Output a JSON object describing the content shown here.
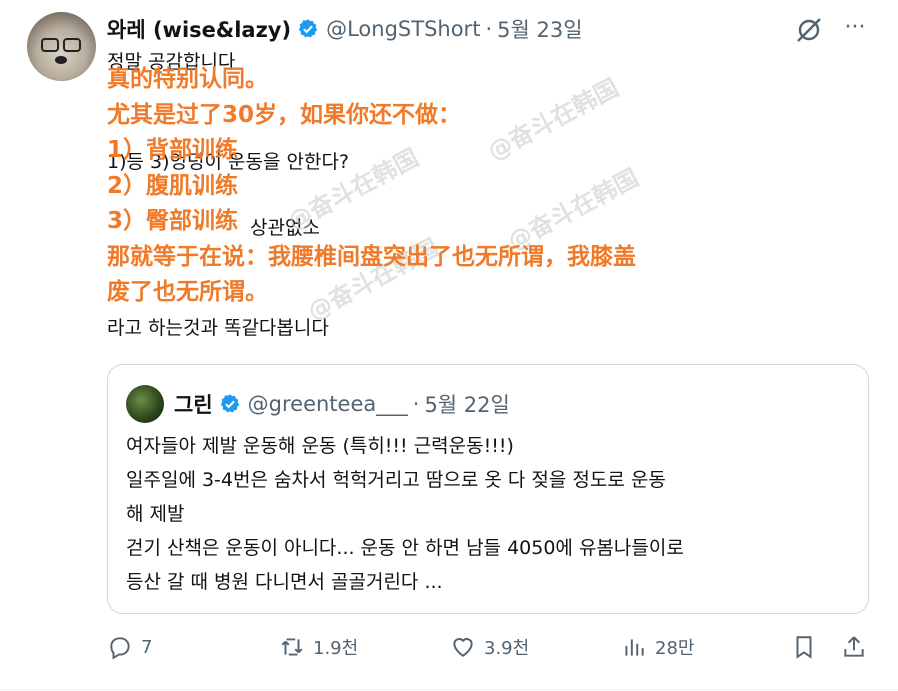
{
  "author": {
    "name": "와레 (wise&lazy)",
    "handle": "@LongSTShort",
    "date": "5월 23일"
  },
  "tweet_lines": [
    "정말 공감합니다",
    "",
    "1)등    3)엉덩이 운동을 안한다?",
    "",
    "    상관없소",
    "",
    "",
    "라고 하는것과 똑같다봅니다"
  ],
  "overlay_lines": [
    "真的特别认同。",
    "尤其是过了30岁，如果你还不做：",
    "1）背部训练",
    "2）腹肌训练",
    "3）臀部训练",
    "那就等于在说：我腰椎间盘突出了也无所谓，我膝盖",
    "废了也无所谓。"
  ],
  "watermarks": [
    "@奋斗在韩国",
    "@奋斗在韩国",
    "@奋斗在韩国",
    "@奋斗在韩国"
  ],
  "quote": {
    "name": "그린",
    "handle": "@greenteea___",
    "date": "5월 22일",
    "lines": [
      "여자들아 제발 운동해 운동 (특히!!! 근력운동!!!)",
      "일주일에 3-4번은 숨차서 헉헉거리고 땀으로 옷 다 젖을 정도로 운동",
      "해 제발",
      "걷기 산책은 운동이 아니다... 운동 안 하면 남들 4050에 유봄나들이로",
      "등산 갈 때 병원 다니면서 골골거린다  ..."
    ]
  },
  "actions": {
    "replies": "7",
    "reposts": "1.9천",
    "likes": "3.9천",
    "views": "28만"
  },
  "colors": {
    "overlay": "#f07a28",
    "verified": "#1d9bf0",
    "secondary_text": "#536471"
  }
}
